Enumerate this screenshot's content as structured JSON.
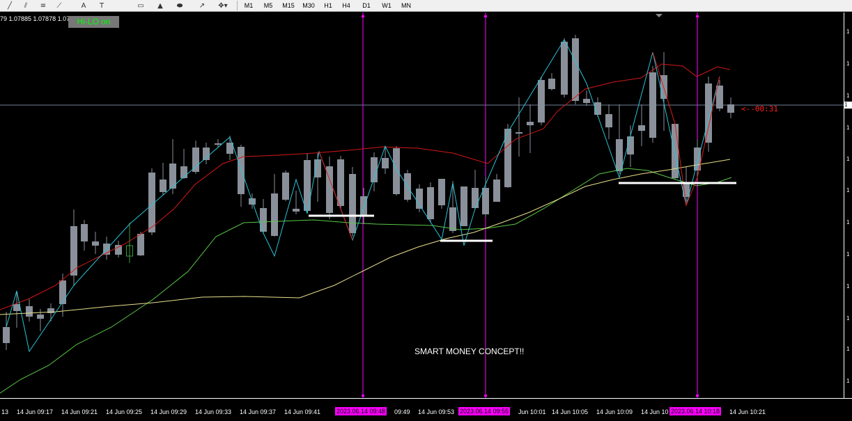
{
  "toolbar": {
    "timeframes": [
      "M1",
      "M5",
      "M15",
      "M30",
      "H1",
      "H4",
      "D1",
      "W1",
      "MN"
    ],
    "tools": [
      {
        "icon": "trendline-icon",
        "glyph": "╱"
      },
      {
        "icon": "channel-icon",
        "glyph": "⫽"
      },
      {
        "icon": "fibo-icon",
        "glyph": "≡"
      },
      {
        "icon": "fibo-fan-icon",
        "glyph": "⟋"
      },
      {
        "icon": "text-icon",
        "glyph": "A"
      },
      {
        "icon": "text-label-icon",
        "glyph": "T"
      },
      {
        "icon": "rectangle-icon",
        "glyph": "▭"
      },
      {
        "icon": "triangle-icon",
        "glyph": "▲"
      },
      {
        "icon": "ellipse-icon",
        "glyph": "⬬"
      },
      {
        "icon": "arrow-icon",
        "glyph": "↗"
      },
      {
        "icon": "more-tools-icon",
        "glyph": "✥▾"
      }
    ]
  },
  "chart": {
    "ohlc_text": "79 1.07885 1.07878 1.07",
    "indicator_button": "Hi-LO on",
    "annotation": "SMART MONEY CONCEPT!!",
    "countdown": "<--00:31",
    "price_tick_glyph": "1",
    "current_price_label": "1",
    "colors": {
      "background": "#000000",
      "bull": "#3c9c3c",
      "bear": "#8a909a",
      "zigzag": "#29c4d8",
      "zigzag_alt": "#e21b1b",
      "ma_fast": "#d41818",
      "ma_mid": "#5ac948",
      "ma_slow": "#e8e08a",
      "vline": "#ff00ff",
      "level": "#ffffff"
    }
  },
  "time_axis": {
    "labels": [
      "13",
      "14 Jun 09:17",
      "14 Jun 09:21",
      "14 Jun 09:25",
      "14 Jun 09:29",
      "14 Jun 09:33",
      "14 Jun 09:37",
      "14 Jun 09:41",
      "09:49",
      "14 Jun 09:53",
      "Jun 10:01",
      "14 Jun 10:05",
      "14 Jun 10:09",
      "14 Jun 10",
      "14 Jun 10:21"
    ],
    "badges": [
      "2023.06.14 09:48",
      "2023.06.14 09:55",
      "2023.06.14 10:18"
    ]
  }
}
